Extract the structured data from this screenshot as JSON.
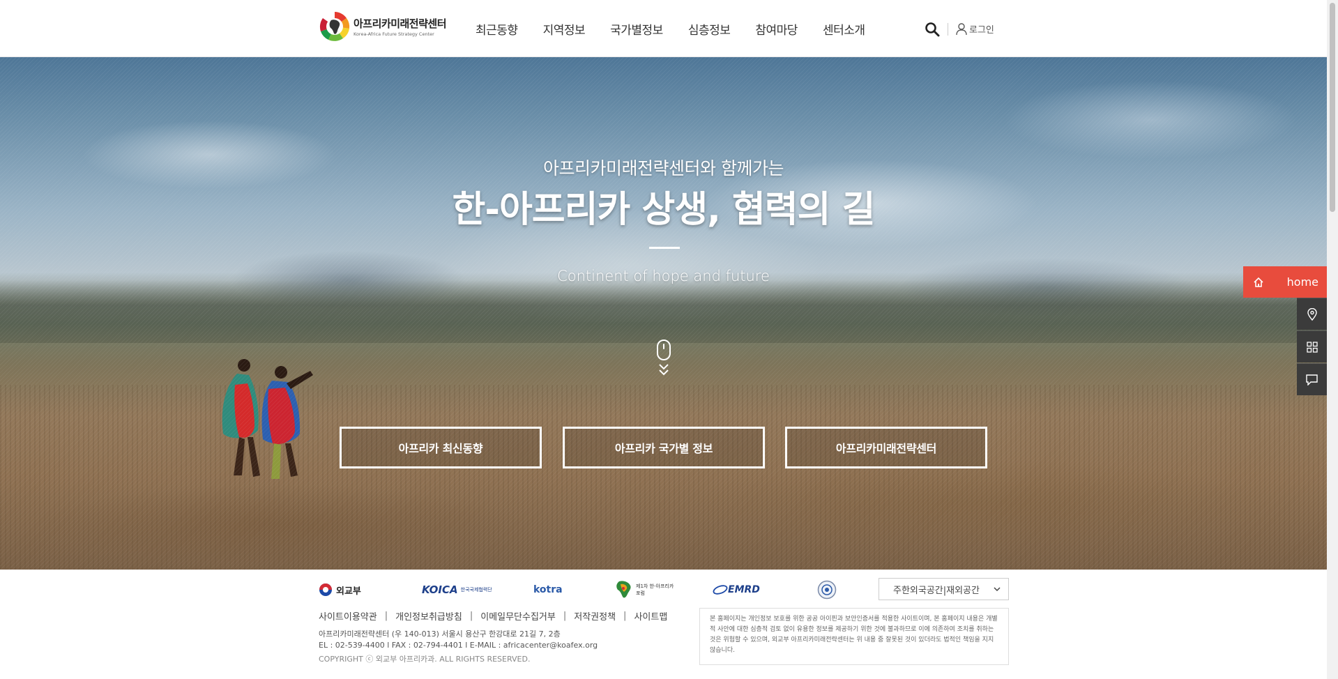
{
  "header": {
    "logo": {
      "name_ko": "아프리카미래전략센터",
      "name_en": "Korea-Africa Future Strategy Center"
    },
    "nav": [
      "최근동향",
      "지역정보",
      "국가별정보",
      "심층정보",
      "참여마당",
      "센터소개"
    ],
    "search_icon": "search-icon",
    "login_label": "로그인"
  },
  "hero": {
    "subtitle": "아프리카미래전략센터와 함께가는",
    "title": "한-아프리카 상생, 협력의 길",
    "english": "Continent of hope and future",
    "buttons": [
      "아프리카 최신동향",
      "아프리카 국가별 정보",
      "아프리카미래전략센터"
    ]
  },
  "quick_menu": {
    "home_label": "home",
    "icons": [
      "map-pin-icon",
      "grid-icon",
      "chat-icon"
    ],
    "accent": "#e84c3d"
  },
  "footer": {
    "partners": [
      "외교부",
      "KOICA",
      "kotra",
      "제1차 한-아프리카 포럼",
      "EMRD",
      "emblem"
    ],
    "embassy_select": "주한외국공간|재외공간",
    "links": [
      "사이트이용약관",
      "개인정보취급방침",
      "이메일무단수집거부",
      "저작권정책",
      "사이트맵"
    ],
    "address": "아프리카미래전략센터 (우 140-013) 서울시 용산구 한강대로 21길 7, 2층",
    "contact": "EL : 02-539-4400 l FAX : 02-794-4401 l E-MAIL : africacenter@koafex.org",
    "copyright": "COPYRIGHT ⓒ 외교부 아프리카과. ALL RIGHTS RESERVED.",
    "notice": "본 홈페이지는 개인정보 보호를 위한 공공 아이핀과 보안인증서를 적용한 사이트이며, 본 홈페이지 내용은 개별적 사안에 대한 심층적 검토 없이 유용한 정보를 제공하기 위한 것에 불과하므로 이에 의존하여 조치를 취하는 것은 위험할 수 있으며, 외교부 아프리카미래전략센터는 위 내용 중 잘못된 것이 있더라도 법적인 책임을 지지 않습니다."
  }
}
